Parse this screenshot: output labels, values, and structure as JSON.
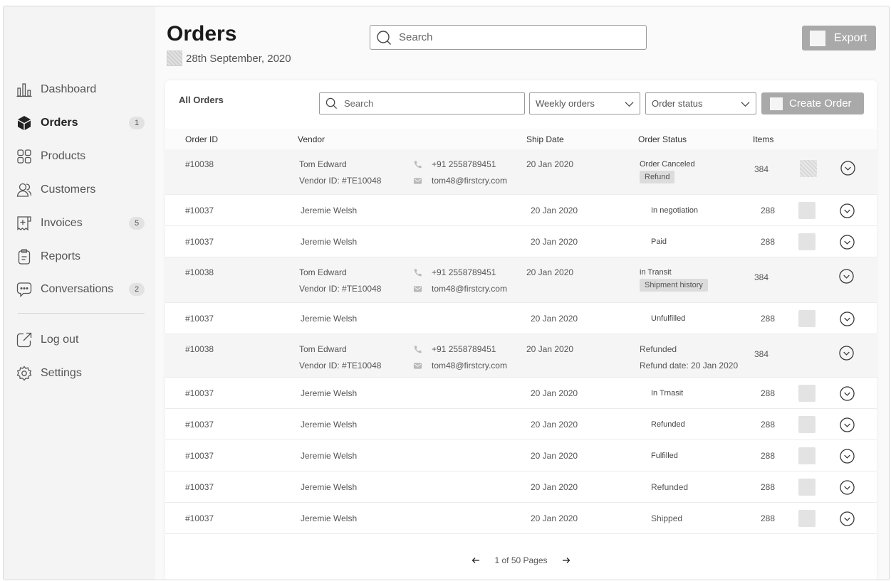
{
  "sidebar": {
    "items": [
      {
        "label": "Dashboard",
        "icon": "bar-chart-icon",
        "badge": ""
      },
      {
        "label": "Orders",
        "icon": "box-icon",
        "badge": "1"
      },
      {
        "label": "Products",
        "icon": "grid-icon",
        "badge": ""
      },
      {
        "label": "Customers",
        "icon": "users-icon",
        "badge": ""
      },
      {
        "label": "Invoices",
        "icon": "invoice-icon",
        "badge": "5"
      },
      {
        "label": "Reports",
        "icon": "clipboard-icon",
        "badge": ""
      },
      {
        "label": "Conversations",
        "icon": "chat-icon",
        "badge": "2"
      }
    ],
    "bottom": [
      {
        "label": "Log out",
        "icon": "logout-icon"
      },
      {
        "label": "Settings",
        "icon": "gear-icon"
      }
    ]
  },
  "header": {
    "title": "Orders",
    "date": "28th September, 2020",
    "search_placeholder": "Search",
    "export_label": "Export"
  },
  "card": {
    "title": "All Orders",
    "search_placeholder": "Search",
    "filter_period": "Weekly orders",
    "filter_status": "Order status",
    "create_label": "Create Order"
  },
  "table": {
    "columns": [
      "Order ID",
      "Vendor",
      "Ship Date",
      "Order Status",
      "Items"
    ],
    "rows": [
      {
        "id": "#10038",
        "vendor": "Tom Edward",
        "vendor_id": "Vendor ID: #TE10048",
        "phone": "+91 2558789451",
        "email": "tom48@firstcry.com",
        "date": "20 Jan 2020",
        "status": "Order Canceled",
        "tag": "Refund",
        "items": "384"
      },
      {
        "id": "#10037",
        "vendor": "Jeremie Welsh",
        "date": "20 Jan 2020",
        "status": "In negotiation",
        "items": "288"
      },
      {
        "id": "#10037",
        "vendor": "Jeremie Welsh",
        "date": "20 Jan 2020",
        "status": "Paid",
        "items": "288"
      },
      {
        "id": "#10038",
        "vendor": "Tom Edward",
        "vendor_id": "Vendor ID: #TE10048",
        "phone": "+91 2558789451",
        "email": "tom48@firstcry.com",
        "date": "20 Jan 2020",
        "status": "in Transit",
        "tag": "Shipment history",
        "items": "384"
      },
      {
        "id": "#10037",
        "vendor": "Jeremie Welsh",
        "date": "20 Jan 2020",
        "status": "Unfulfilled",
        "items": "288"
      },
      {
        "id": "#10038",
        "vendor": "Tom Edward",
        "vendor_id": "Vendor ID: #TE10048",
        "phone": "+91 2558789451",
        "email": "tom48@firstcry.com",
        "date": "20 Jan 2020",
        "status": "Refunded",
        "sub": "Refund date: 20 Jan 2020",
        "items": "384"
      },
      {
        "id": "#10037",
        "vendor": "Jeremie Welsh",
        "date": "20 Jan 2020",
        "status": "In Trnasit",
        "items": "288"
      },
      {
        "id": "#10037",
        "vendor": "Jeremie Welsh",
        "date": "20 Jan 2020",
        "status": "Refunded",
        "items": "288"
      },
      {
        "id": "#10037",
        "vendor": "Jeremie Welsh",
        "date": "20 Jan 2020",
        "status": "Fulfilled",
        "items": "288"
      },
      {
        "id": "#10037",
        "vendor": "Jeremie Welsh",
        "date": "20 Jan 2020",
        "status": "Refunded",
        "items": "288"
      },
      {
        "id": "#10037",
        "vendor": "Jeremie Welsh",
        "date": "20 Jan 2020",
        "status": "Shipped",
        "items": "288"
      }
    ]
  },
  "pagination": {
    "label": "1 of 50 Pages",
    "prev_icon": "arrow-left-icon",
    "next_icon": "arrow-right-icon"
  }
}
